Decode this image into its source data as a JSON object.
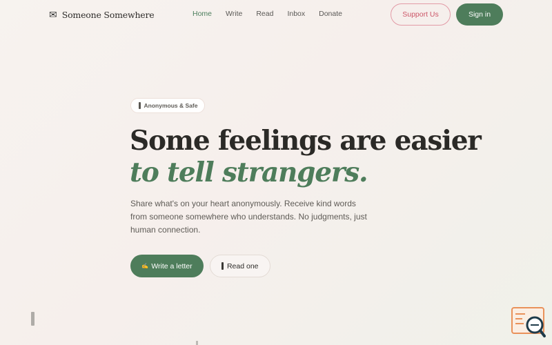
{
  "nav": {
    "brand_icon": "envelope-icon",
    "brand_icon_glyph": "✉",
    "brand_name": "Someone Somewhere",
    "links": [
      {
        "label": "Home",
        "active": true
      },
      {
        "label": "Write",
        "active": false
      },
      {
        "label": "Read",
        "active": false
      },
      {
        "label": "Inbox",
        "active": false
      },
      {
        "label": "Donate",
        "active": false
      }
    ],
    "support_label": "Support Us",
    "signin_label": "Sign in"
  },
  "hero": {
    "badge_label": "Anonymous & Safe",
    "title_line1": "Some feelings are easier",
    "title_line2": "to tell strangers.",
    "description": "Share what's on your heart anonymously. Receive kind words from someone somewhere who understands. No judgments, just human connection.",
    "write_icon_glyph": "✍",
    "write_label": "Write a letter",
    "read_label": "Read one"
  },
  "colors": {
    "accent_green": "#4e7d5b",
    "accent_pink": "#cc5567",
    "background": "#f7f3ef",
    "text_dark": "#2b2a27"
  },
  "widget": {
    "icon": "search-chat-icon"
  }
}
